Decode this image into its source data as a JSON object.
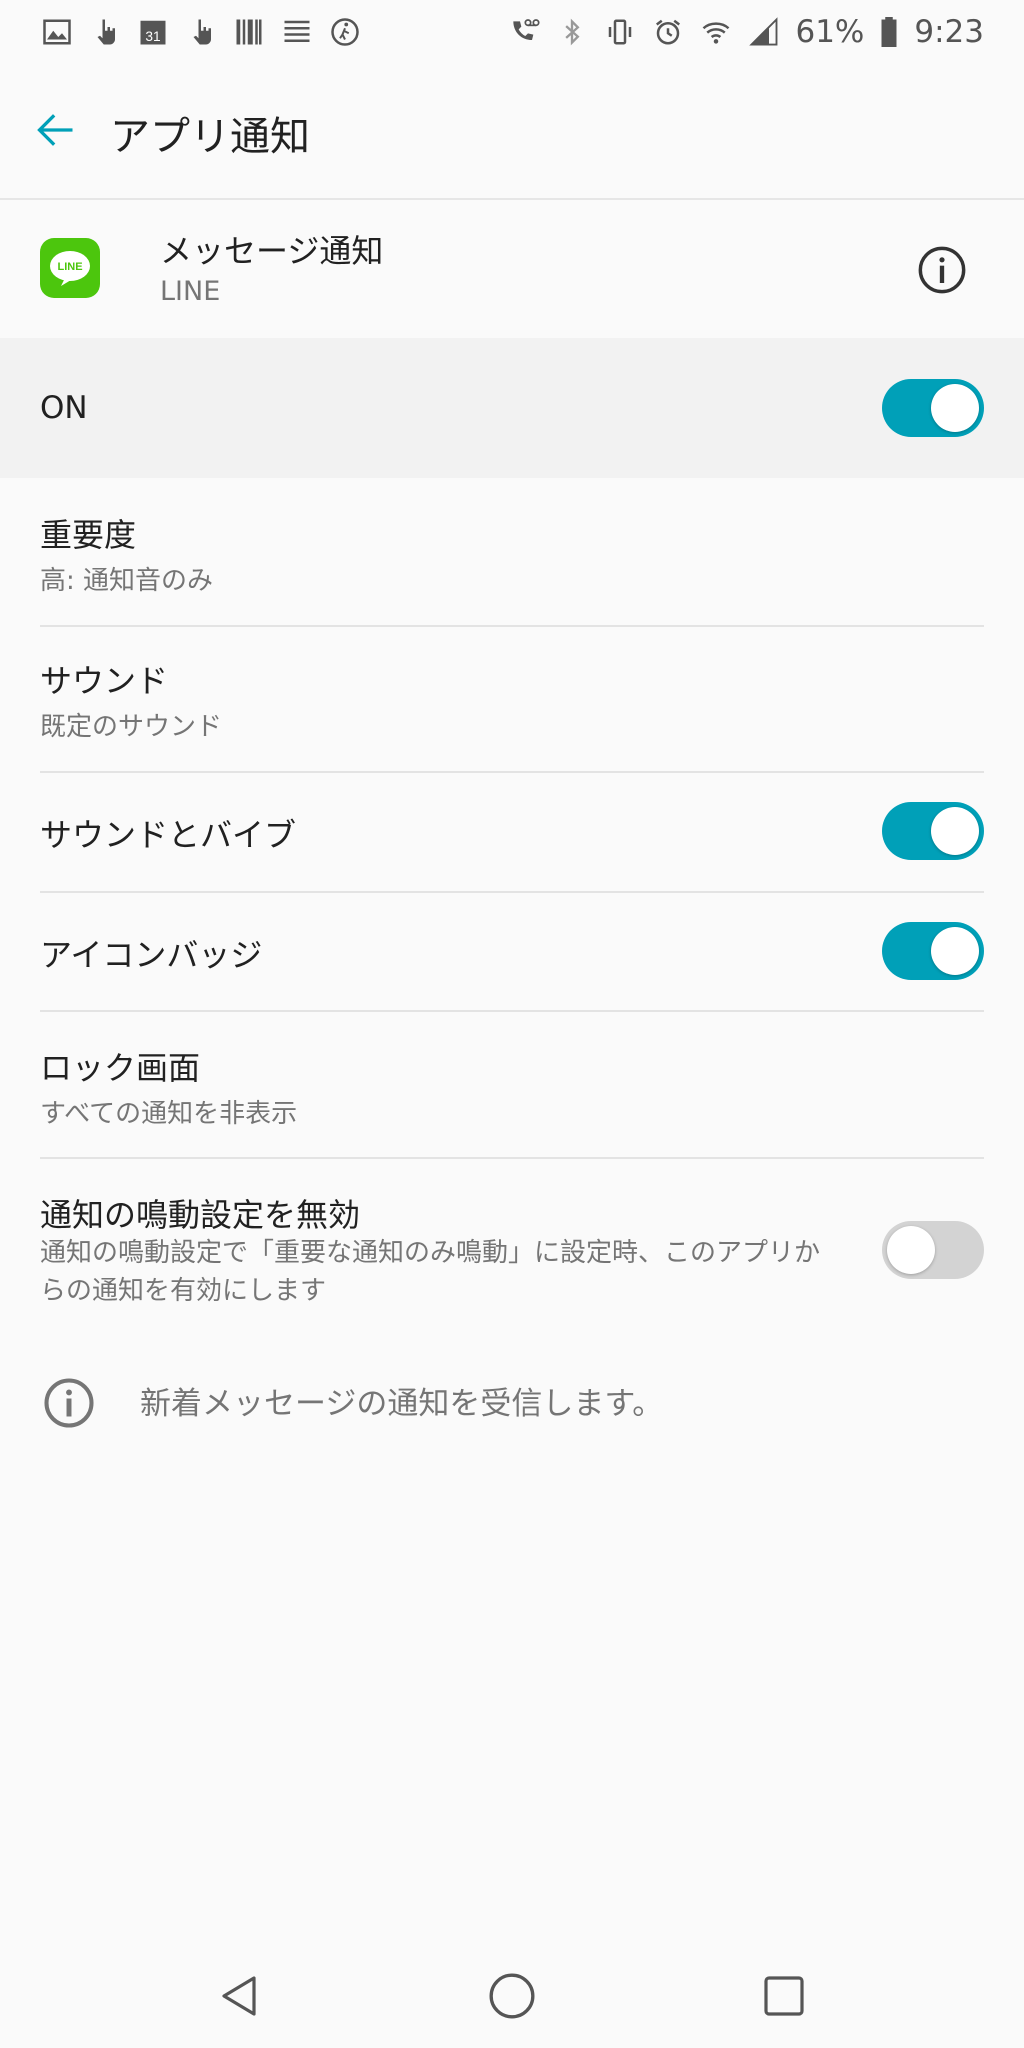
{
  "status_bar": {
    "battery": "61%",
    "time": "9:23",
    "calendar_day": "31",
    "left_icons": [
      "image-icon",
      "touch-icon",
      "calendar-icon",
      "touch-icon",
      "barcode-icon",
      "list-icon",
      "walk-icon"
    ],
    "right_icons": [
      "voicemail-icon",
      "bluetooth-icon",
      "vibrate-icon",
      "alarm-icon",
      "wifi-icon",
      "signal-icon",
      "battery-icon"
    ]
  },
  "app_bar": {
    "title": "アプリ通知"
  },
  "app_header": {
    "app_icon_text": "LINE",
    "name": "メッセージ通知",
    "sub": "LINE"
  },
  "on_row": {
    "label": "ON",
    "enabled": true
  },
  "settings": {
    "importance": {
      "title": "重要度",
      "sub": "高: 通知音のみ"
    },
    "sound": {
      "title": "サウンド",
      "sub": "既定のサウンド"
    },
    "sound_vibrate": {
      "title": "サウンドとバイブ",
      "enabled": true
    },
    "icon_badge": {
      "title": "アイコンバッジ",
      "enabled": true
    },
    "lock_screen": {
      "title": "ロック画面",
      "sub": "すべての通知を非表示"
    },
    "dnd_override": {
      "title": "通知の鳴動設定を無効",
      "sub": "通知の鳴動設定で「重要な通知のみ鳴動」に設定時、このアプリからの通知を有効にします",
      "enabled": false
    }
  },
  "footer": {
    "text": "新着メッセージの通知を受信します。"
  },
  "colors": {
    "accent": "#00a0b8",
    "line_green": "#4cc60d",
    "toggle_off": "#d3d3d3"
  }
}
